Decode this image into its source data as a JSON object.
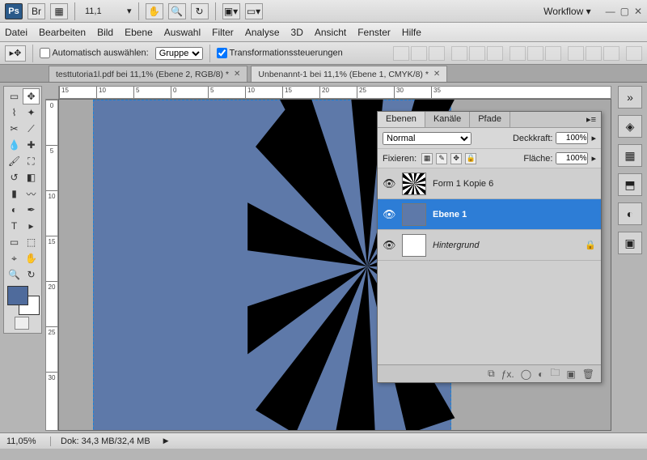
{
  "topbar": {
    "zoom": "11,1",
    "workflow": "Workflow ▾"
  },
  "menu": [
    "Datei",
    "Bearbeiten",
    "Bild",
    "Ebene",
    "Auswahl",
    "Filter",
    "Analyse",
    "3D",
    "Ansicht",
    "Fenster",
    "Hilfe"
  ],
  "options": {
    "auto_select": "Automatisch auswählen:",
    "group": "Gruppe",
    "transform": "Transformationssteuerungen"
  },
  "tabs": [
    {
      "label": "testtutoria1l.pdf bei 11,1% (Ebene 2, RGB/8) *",
      "active": false
    },
    {
      "label": "Unbenannt-1 bei 11,1% (Ebene 1, CMYK/8) *",
      "active": true
    }
  ],
  "ruler_h": [
    "15",
    "10",
    "5",
    "0",
    "5",
    "10",
    "15",
    "20",
    "25",
    "30",
    "35"
  ],
  "ruler_v": [
    "0",
    "5",
    "10",
    "15",
    "20",
    "25",
    "30"
  ],
  "panel": {
    "tabs": {
      "ebenen": "Ebenen",
      "kanale": "Kanäle",
      "pfade": "Pfade"
    },
    "blend": "Normal",
    "opacity_label": "Deckkraft:",
    "opacity": "100%",
    "lock_label": "Fixieren:",
    "fill_label": "Fläche:",
    "fill": "100%",
    "layers": [
      {
        "name": "Form 1 Kopie 6",
        "kind": "swirl",
        "selected": false,
        "locked": false
      },
      {
        "name": "Ebene 1",
        "kind": "blue",
        "selected": true,
        "locked": false
      },
      {
        "name": "Hintergrund",
        "kind": "white",
        "selected": false,
        "locked": true
      }
    ]
  },
  "status": {
    "zoom": "11,05%",
    "doc": "Dok: 34,3 MB/32,4 MB"
  },
  "colors": {
    "canvas": "#5e79a9",
    "accent": "#2d7dd6"
  }
}
